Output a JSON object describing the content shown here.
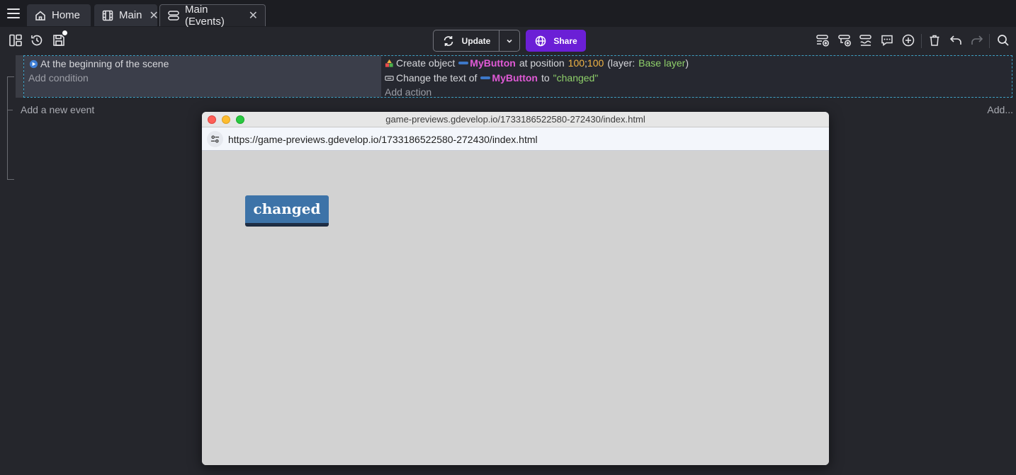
{
  "tabs": [
    {
      "label": "Home",
      "icon": "home-icon"
    },
    {
      "label": "Main",
      "icon": "film-icon"
    },
    {
      "label": "Main (Events)",
      "icon": "events-icon"
    }
  ],
  "toolbar": {
    "update_label": "Update",
    "share_label": "Share",
    "share_color": "#6b1fd6"
  },
  "event": {
    "condition_text": "At the beginning of the scene",
    "add_condition": "Add condition",
    "action1": {
      "prefix": "Create object",
      "object": "MyButton",
      "middle": "at position",
      "x": "100",
      "sep": ";",
      "y": "100",
      "layer_open": "(layer:",
      "layer": "Base layer",
      "layer_close": ")"
    },
    "action2": {
      "prefix": "Change the text of",
      "object": "MyButton",
      "middle": "to",
      "value": "\"changed\""
    },
    "add_action": "Add action"
  },
  "add_new_event": "Add a new event",
  "add_more": "Add...",
  "preview": {
    "window_title": "game-previews.gdevelop.io/1733186522580-272430/index.html",
    "url": "https://game-previews.gdevelop.io/1733186522580-272430/index.html",
    "button_text": "changed"
  }
}
